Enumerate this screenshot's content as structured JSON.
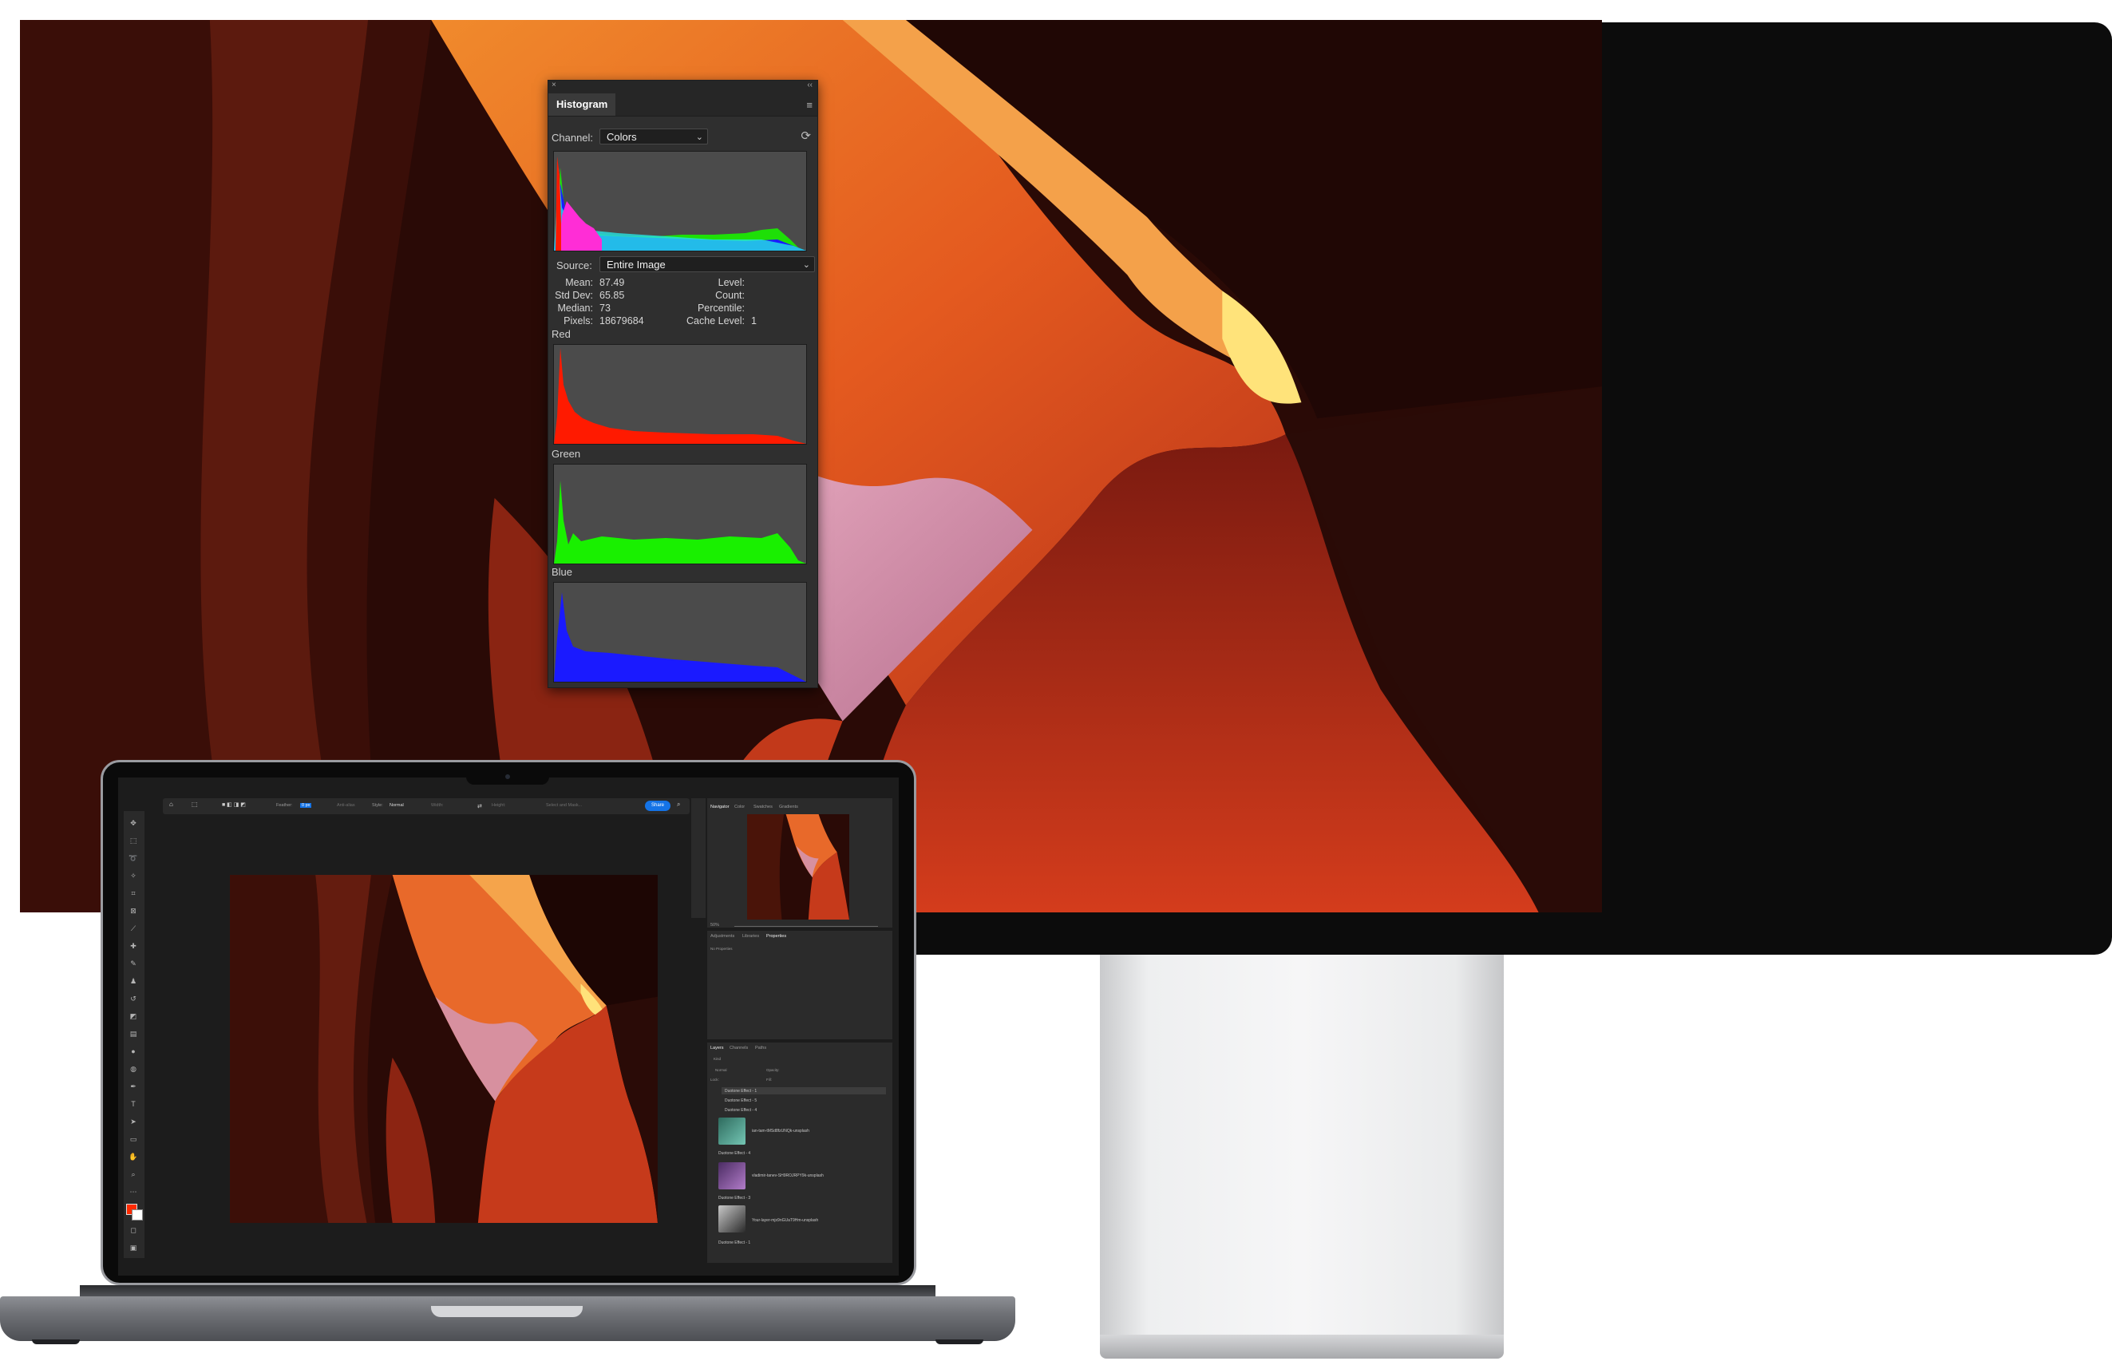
{
  "histogram": {
    "tab_title": "Histogram",
    "close_glyph": "×",
    "collapse_glyph": "‹‹",
    "menu_glyph": "≡",
    "channel_label": "Channel:",
    "channel_value": "Colors",
    "source_label": "Source:",
    "source_value": "Entire Image",
    "refresh_glyph": "⟳",
    "stats": {
      "mean_label": "Mean:",
      "mean": "87.49",
      "std_label": "Std Dev:",
      "std": "65.85",
      "median_label": "Median:",
      "median": "73",
      "pixels_label": "Pixels:",
      "pixels": "18679684",
      "level_label": "Level:",
      "count_label": "Count:",
      "percentile_label": "Percentile:",
      "cache_label": "Cache Level:",
      "cache": "1"
    },
    "channels": [
      "Red",
      "Green",
      "Blue"
    ],
    "colors": {
      "red": "#ff1a00",
      "green": "#19f000",
      "blue": "#1a1aff",
      "cyan": "#25e4e4",
      "magenta": "#ff2dd6",
      "panel": "#2f2f2f"
    }
  },
  "laptop_app": {
    "options": {
      "feather_label": "Feather:",
      "feather_value": "0 px",
      "anti_alias": "Anti-alias",
      "style_label": "Style:",
      "style_value": "Normal",
      "width_label": "Width:",
      "height_label": "Height:",
      "select_mask": "Select and Mask...",
      "share_label": "Share"
    },
    "panel_tabs": [
      "Navigator",
      "Color",
      "Swatches",
      "Gradients"
    ],
    "zoom": "50%",
    "prop_tabs": [
      "Adjustments",
      "Libraries",
      "Properties"
    ],
    "no_properties": "No Properties",
    "layer_tabs": [
      "Layers",
      "Channels",
      "Paths"
    ],
    "layer_kind": "Kind",
    "layer_mode": "Normal",
    "layer_opacity_label": "Opacity:",
    "layer_fill_label": "Fill:",
    "layer_lock_label": "Lock:",
    "layers": [
      "Duotone Effect - 1",
      "Duotone Effect - 5",
      "Duotone Effect - 4",
      "ian-tam-tMSd8fzUNQk-unsplash",
      "Duotone Effect - 4",
      "vladimir-tanev-SH9ROJRPY9k-unsplash",
      "Duotone Effect - 3",
      "Your-layer-mjx9nGUaT9Hm-unsplash",
      "Duotone Effect - 1"
    ]
  }
}
